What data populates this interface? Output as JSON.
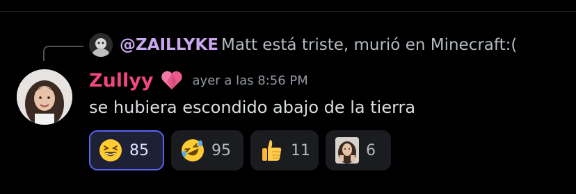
{
  "reply": {
    "author": "@ZAILLYKE",
    "text": "Matt está triste, murió en Minecraft:("
  },
  "message": {
    "author": "Zullyy",
    "author_color": "#f0477d",
    "badge_icon": "heart-icon",
    "timestamp": "ayer a las 8:56 PM",
    "text": "se hubiera escondido abajo de la tierra"
  },
  "reactions": [
    {
      "icon": "grinning-squinting-face-icon",
      "count": "85",
      "selected": true
    },
    {
      "icon": "rolling-on-floor-laughing-icon",
      "count": "95",
      "selected": false
    },
    {
      "icon": "thumbs-up-icon",
      "count": "11",
      "selected": false
    },
    {
      "icon": "custom-photo-emoji-icon",
      "count": "6",
      "selected": false
    }
  ],
  "colors": {
    "background": "#000000",
    "reply_author": "#c9a7f0",
    "selected_reaction_border": "#5865f2"
  }
}
